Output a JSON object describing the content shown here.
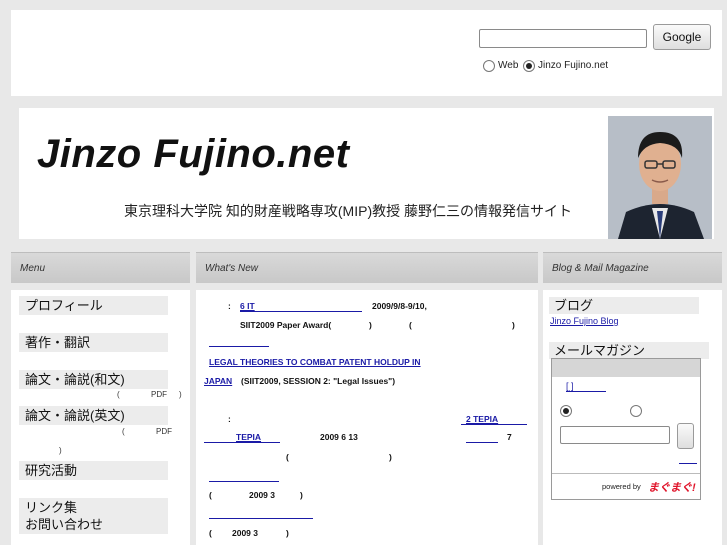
{
  "search": {
    "input_value": "",
    "button_label": "Google",
    "option_web": "Web",
    "option_site": "Jinzo Fujino.net"
  },
  "banner": {
    "title": "Jinzo Fujino.net",
    "subtitle": "東京理科大学院 知的財産戦略専攻(MIP)教授 藤野仁三の情報発信サイト"
  },
  "columns": {
    "menu": "Menu",
    "whats_new": "What's New",
    "blog_mail": "Blog & Mail Magazine"
  },
  "menu": {
    "items": [
      "プロフィール",
      "著作・翻訳",
      "論文・論説(和文)",
      "論文・論説(英文)",
      "研究活動",
      "リンク集",
      "お問い合わせ"
    ],
    "note_pdf": "PDF"
  },
  "news": {
    "l1_prefix": ":",
    "l1_link": "6 IT",
    "l1_date": "2009/9/8-9/10,",
    "l2": "SIIT2009 Paper Award(",
    "l3_link_a": "LEGAL THEORIES TO COMBAT PATENT HOLDUP IN",
    "l3_link_b": "JAPAN",
    "l3_rest": "(SIIT2009, SESSION 2: \"Legal Issues\")",
    "l4_link": "2 TEPIA",
    "l5_link": "TEPIA",
    "l5_date": "2009 6 13",
    "l5_num": "7",
    "l6": "2009 3",
    "l7": "2009 3"
  },
  "right": {
    "blog_head": "ブログ",
    "blog_link": "Jinzo Fujino Blog",
    "mail_head": "メールマガジン",
    "mail_bracket": "[ ]",
    "powered_by": "powered by",
    "logo": "まぐまぐ!"
  }
}
